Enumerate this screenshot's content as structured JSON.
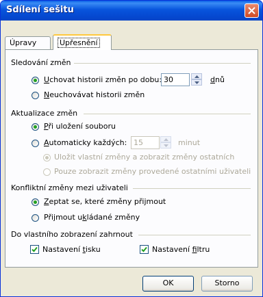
{
  "window": {
    "title": "Sdílení sešitu"
  },
  "tabs": {
    "edits": "Úpravy",
    "advanced": "Upřesnění"
  },
  "track": {
    "heading": "Sledování změn",
    "keep_a": "U",
    "keep_b": "chovat historii změn po dobu:",
    "days_value": "30",
    "days_a": "d",
    "days_b": "nů",
    "dont_a": "N",
    "dont_b": "euchovávat historii změn"
  },
  "update": {
    "heading": "Aktualizace změn",
    "save_a": "P",
    "save_b": "ři uložení souboru",
    "auto_a": "A",
    "auto_b": "utomaticky každých:",
    "minutes_value": "15",
    "minutes_label": "minut",
    "save_mine": "Uložit vlastní změny a zobrazit změny ostatních",
    "see_others": "Pouze zobrazit změny provedené ostatními uživateli"
  },
  "conflict": {
    "heading": "Konfliktní změny mezi uživateli",
    "ask_a": "Z",
    "ask_b": "eptat se, které změny přijmout",
    "saved_a": "Přijmout u",
    "saved_b": "k",
    "saved_c": "ládané změny"
  },
  "include": {
    "heading": "Do vlastního zobrazení zahrnout",
    "print_a": "Nastavení ",
    "print_b": "t",
    "print_c": "isku",
    "filter_a": "Nastavení ",
    "filter_b": "f",
    "filter_c": "iltru"
  },
  "buttons": {
    "ok": "OK",
    "cancel": "Storno"
  },
  "colors": {
    "titlebar": "#0855dd",
    "dialog_bg": "#ece9d8",
    "tab_highlight": "#ffc83c",
    "radio_dot": "#21a121",
    "close": "#d04a25"
  }
}
